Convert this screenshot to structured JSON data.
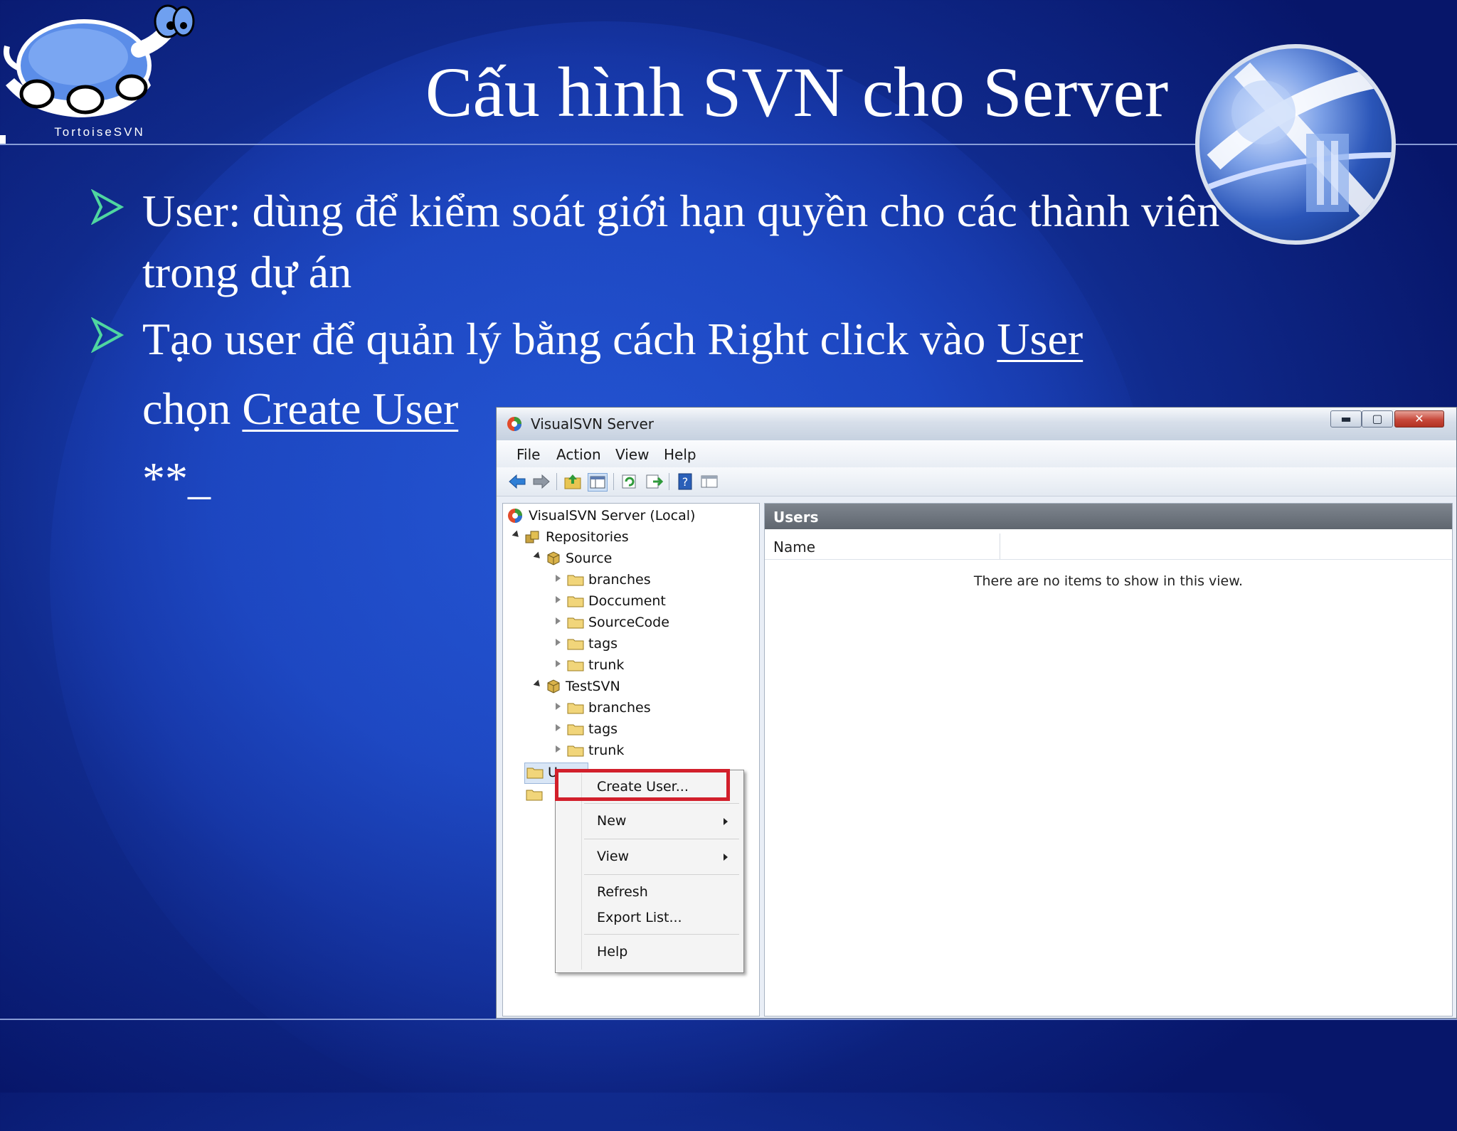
{
  "slide": {
    "title": "Cấu hình SVN cho Server",
    "logo_text": "TortoiseSVN",
    "bullets": [
      {
        "line1": "User: dùng để kiểm soát giới hạn quyền cho các thành viên",
        "line2": "trong dự án"
      },
      {
        "text": "Tạo user để quản lý bằng cách Right click vào ",
        "link": "User",
        "text2": "chọn ",
        "link2": "Create User"
      }
    ],
    "extra": "**_"
  },
  "window": {
    "title": "VisualSVN Server",
    "controls": {
      "min": "▬",
      "max": "▢",
      "close": "✕"
    },
    "menu": [
      "File",
      "Action",
      "View",
      "Help"
    ],
    "tree": {
      "root": "VisualSVN Server (Local)",
      "repositories": "Repositories",
      "source": "Source",
      "source_children": [
        "branches",
        "Doccument",
        "SourceCode",
        "tags",
        "trunk"
      ],
      "testsvn": "TestSVN",
      "testsvn_children": [
        "branches",
        "tags",
        "trunk"
      ],
      "users": "Users"
    },
    "right_pane": {
      "header": "Users",
      "column": "Name",
      "empty_message": "There are no items to show in this view."
    }
  },
  "context_menu": {
    "items": [
      "Create User...",
      "New",
      "View",
      "Refresh",
      "Export List...",
      "Help"
    ]
  }
}
